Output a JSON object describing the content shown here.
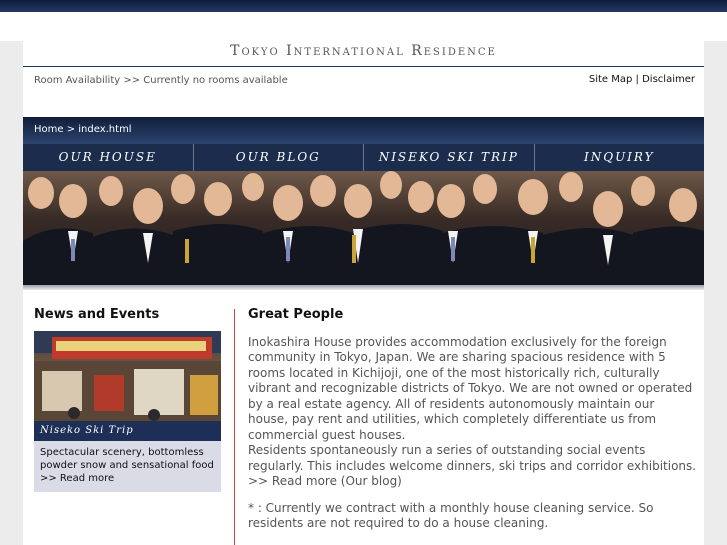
{
  "site": {
    "title": "Tokyo International Residence"
  },
  "header": {
    "status": "Room Availability >> Currently no rooms available",
    "links": {
      "site_map": "Site Map",
      "separator": "|",
      "disclaimer": "Disclaimer"
    }
  },
  "breadcrumb": {
    "text": "Home > index.html"
  },
  "nav": {
    "items": [
      {
        "label": "Our House"
      },
      {
        "label": "Our Blog"
      },
      {
        "label": "Niseko Ski Trip"
      },
      {
        "label": "Inquiry"
      }
    ]
  },
  "colors": {
    "nav_bar": "#1b2b4a",
    "accent_rule": "#b84a4a",
    "news_box": "#d9dbe7",
    "caption_bar": "#1e2f57"
  },
  "news": {
    "heading": "News and Events",
    "image_caption": "Niseko Ski Trip",
    "body": "Spectacular scenery, bottomless powder snow and sensational food",
    "read_more": ">> Read more"
  },
  "main": {
    "heading": "Great People",
    "paragraph1": "Inokashira House provides accommodation exclusively for the foreign community in Tokyo, Japan. We are sharing spacious residence with 5 rooms located in Kichijoji, one of the most historically rich, culturally vibrant and recognizable districts of Tokyo. We are not owned or operated by a real estate agency. All of residents autonomously maintain our house, pay rent and utilities, which completely differentiate us from commercial guest houses.",
    "paragraph2": "Residents spontaneously run a series of outstanding social events regularly. This includes welcome dinners, ski trips and corridor exhibitions.",
    "paragraph2_link": ">> Read more (Our blog)",
    "note": "* : Currently we contract with a monthly house cleaning service. So residents are not required to do a house cleaning."
  }
}
